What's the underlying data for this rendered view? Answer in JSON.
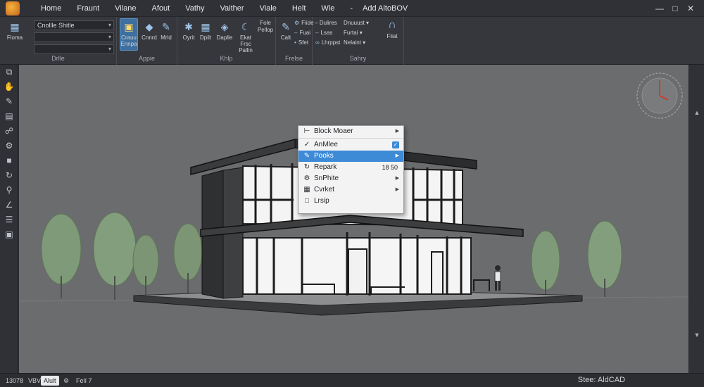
{
  "menu": {
    "items": [
      "Home",
      "Fraunt",
      "Vilane",
      "Afout",
      "Vathy",
      "Vaither",
      "Viale",
      "Helt",
      "Wle",
      "-",
      "Add AltoBOV"
    ]
  },
  "window": {
    "minimize": "—",
    "maximize": "□",
    "close": "✕"
  },
  "ribbon": {
    "draw_group": {
      "label": "Drlle",
      "tool_label": "Fioma",
      "combo1": "Cnollle Shitle",
      "combo2": "",
      "combo3": ""
    },
    "apply_group": {
      "label": "Appie",
      "tool1": "Crauu\nEnnpa",
      "tool2": "Cnnrd",
      "tool3": "Mrld"
    },
    "help_group": {
      "label": "Khlp",
      "tool1": "Oyrit",
      "tool2": "Dpilt",
      "tool3": "Daplle",
      "tool4": "Ekat\nFrsc\nPallin",
      "tool5": "Fole\nPellop"
    },
    "prefs_group": {
      "label": "Frelse",
      "tool1": "Calt",
      "r1": "Fiide",
      "r2": "Fuai",
      "r3": "Sfet"
    },
    "safety_group": {
      "label": "Sahry",
      "r1": "Dulires",
      "r2": "Lsas",
      "r3": "Lhrppst",
      "r4": "Dnuuust",
      "r5": "Furtai",
      "r6": "Nelaint",
      "tool1": "Fiiat"
    }
  },
  "context_menu": {
    "items": [
      {
        "label": "Block Moaer",
        "icon": "arrow-icon",
        "submenu": true
      },
      {
        "label": "AnMlee",
        "icon": "check-icon",
        "checked": true
      },
      {
        "label": "Pooks",
        "icon": "pen-icon",
        "submenu": true,
        "selected": true
      },
      {
        "label": "Repark",
        "icon": "circle-arrow-icon",
        "value": "18 50"
      },
      {
        "label": "SnPhite",
        "icon": "gear-icon",
        "submenu": true
      },
      {
        "label": "Cvrket",
        "icon": "grid-icon",
        "submenu": true
      },
      {
        "label": "Lrsip",
        "icon": "box-icon"
      }
    ]
  },
  "statusbar": {
    "tabs": [
      "13078",
      "VBV",
      "Alult",
      "⚙",
      "Felí 7"
    ],
    "active_tab": "Alult",
    "status_text": "Stee: AldCAD"
  },
  "colors": {
    "accent": "#3d8ad6",
    "viewport_bg": "#6b6c6e",
    "viewcube_needle": "#d23b2b"
  }
}
